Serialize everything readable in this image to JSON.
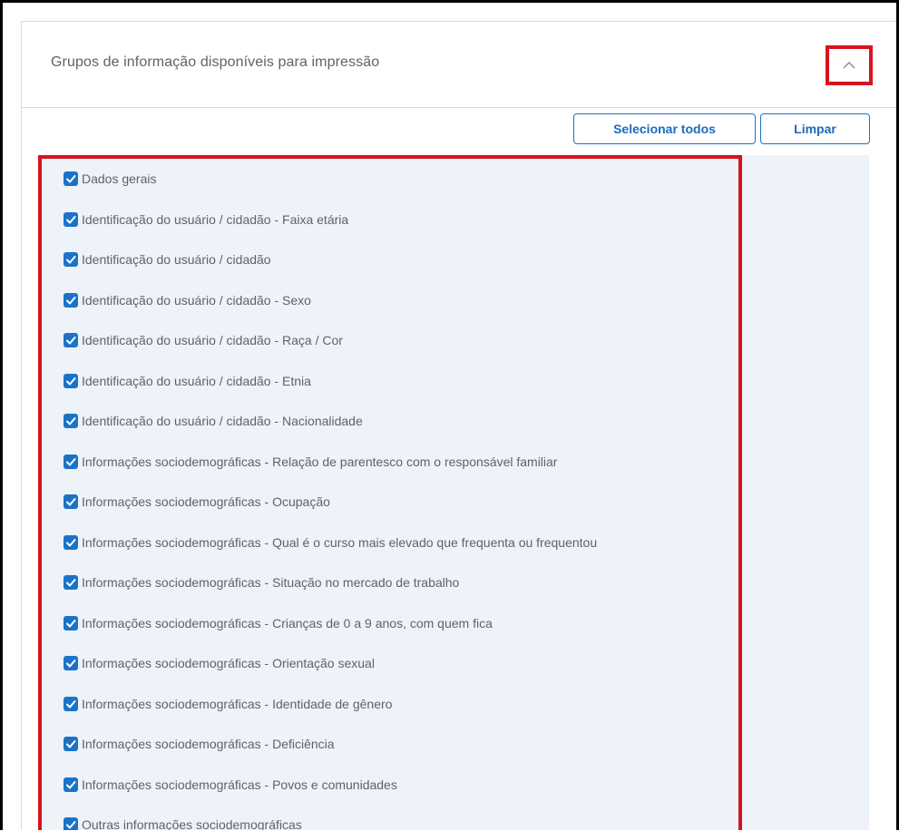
{
  "panel": {
    "title": "Grupos de informação disponíveis para impressão",
    "toggle_icon": "chevron-up-icon"
  },
  "toolbar": {
    "select_all_label": "Selecionar todos",
    "clear_label": "Limpar"
  },
  "colors": {
    "accent": "#1a73c9",
    "highlight": "#d7141e",
    "list_background": "#eef3f9",
    "text": "#5f6368"
  },
  "items": [
    {
      "label": "Dados gerais",
      "checked": true
    },
    {
      "label": "Identificação do usuário / cidadão - Faixa etária",
      "checked": true
    },
    {
      "label": "Identificação do usuário / cidadão",
      "checked": true
    },
    {
      "label": "Identificação do usuário / cidadão - Sexo",
      "checked": true
    },
    {
      "label": "Identificação do usuário / cidadão - Raça / Cor",
      "checked": true
    },
    {
      "label": "Identificação do usuário / cidadão - Etnia",
      "checked": true
    },
    {
      "label": "Identificação do usuário / cidadão - Nacionalidade",
      "checked": true
    },
    {
      "label": "Informações sociodemográficas - Relação de parentesco com o responsável familiar",
      "checked": true
    },
    {
      "label": "Informações sociodemográficas - Ocupação",
      "checked": true
    },
    {
      "label": "Informações sociodemográficas - Qual é o curso mais elevado que frequenta ou frequentou",
      "checked": true
    },
    {
      "label": "Informações sociodemográficas - Situação no mercado de trabalho",
      "checked": true
    },
    {
      "label": "Informações sociodemográficas - Crianças de 0 a 9 anos, com quem fica",
      "checked": true
    },
    {
      "label": "Informações sociodemográficas - Orientação sexual",
      "checked": true
    },
    {
      "label": "Informações sociodemográficas - Identidade de gênero",
      "checked": true
    },
    {
      "label": "Informações sociodemográficas - Deficiência",
      "checked": true
    },
    {
      "label": "Informações sociodemográficas - Povos e comunidades",
      "checked": true
    },
    {
      "label": "Outras informações sociodemográficas",
      "checked": true
    }
  ]
}
